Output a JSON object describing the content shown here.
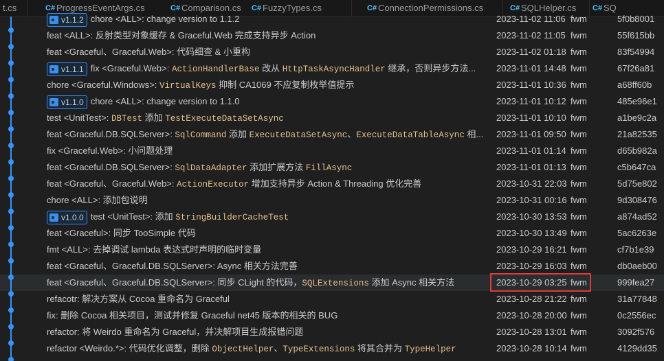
{
  "tabs": [
    {
      "label": "t.cs"
    },
    {
      "label": "ProgressEventArgs.cs"
    },
    {
      "label": "Comparison.cs"
    },
    {
      "label": "FuzzyTypes.cs"
    },
    {
      "label": "ConnectionPermissions.cs"
    },
    {
      "label": "SQLHelper.cs"
    },
    {
      "label": "SQ"
    }
  ],
  "commits": [
    {
      "tag": "v1.1.2",
      "parts": [
        {
          "t": "chore <ALL>: change version to 1.1.2"
        }
      ],
      "date": "2023-11-02 11:06",
      "author": "fwm",
      "hash": "5f0b8001"
    },
    {
      "tag": "",
      "parts": [
        {
          "t": "feat <ALL>: 反射类型对象缓存 & Graceful.Web 完成支持异步 Action"
        }
      ],
      "date": "2023-11-02 11:05",
      "author": "fwm",
      "hash": "55f615bb"
    },
    {
      "tag": "",
      "parts": [
        {
          "t": "feat <Graceful、Graceful.Web>: 代码细查 & 小重构"
        }
      ],
      "date": "2023-11-02 01:18",
      "author": "fwm",
      "hash": "83f54994"
    },
    {
      "tag": "v1.1.1",
      "parts": [
        {
          "t": "fix <Graceful.Web>: "
        },
        {
          "c": "ActionHandlerBase"
        },
        {
          "t": " 改从 "
        },
        {
          "c": "HttpTaskAsyncHandler"
        },
        {
          "t": " 继承，否则异步方法..."
        }
      ],
      "date": "2023-11-01 14:48",
      "author": "fwm",
      "hash": "67f26a81"
    },
    {
      "tag": "",
      "parts": [
        {
          "t": "chore <Graceful.Windows>: "
        },
        {
          "c": "VirtualKeys"
        },
        {
          "t": " 抑制 CA1069 不应复制枚举值提示"
        }
      ],
      "date": "2023-11-01 10:36",
      "author": "fwm",
      "hash": "a68ff60b"
    },
    {
      "tag": "v1.1.0",
      "parts": [
        {
          "t": "chore <ALL>: change version to 1.1.0"
        }
      ],
      "date": "2023-11-01 10:12",
      "author": "fwm",
      "hash": "485e96e1"
    },
    {
      "tag": "",
      "parts": [
        {
          "t": "test <UnitTest>: "
        },
        {
          "c": "DBTest"
        },
        {
          "t": " 添加 "
        },
        {
          "c": "TestExecuteDataSetAsync"
        }
      ],
      "date": "2023-11-01 10:10",
      "author": "fwm",
      "hash": "a1be9c2a"
    },
    {
      "tag": "",
      "parts": [
        {
          "t": "feat <Graceful.DB.SQLServer>: "
        },
        {
          "c": "SqlCommand"
        },
        {
          "t": " 添加 "
        },
        {
          "c": "ExecuteDataSetAsync"
        },
        {
          "t": "、"
        },
        {
          "c": "ExecuteDataTableAsync"
        },
        {
          "t": " 相..."
        }
      ],
      "date": "2023-11-01 09:50",
      "author": "fwm",
      "hash": "21a82535"
    },
    {
      "tag": "",
      "parts": [
        {
          "t": "fix <Graceful.Web>: 小问题处理"
        }
      ],
      "date": "2023-11-01 01:14",
      "author": "fwm",
      "hash": "d65b982a"
    },
    {
      "tag": "",
      "parts": [
        {
          "t": "feat <Graceful.DB.SQLServer>: "
        },
        {
          "c": "SqlDataAdapter"
        },
        {
          "t": " 添加扩展方法 "
        },
        {
          "c": "FillAsync"
        }
      ],
      "date": "2023-11-01 01:13",
      "author": "fwm",
      "hash": "c5b647ca"
    },
    {
      "tag": "",
      "parts": [
        {
          "t": "feat <Graceful、Graceful.Web>: "
        },
        {
          "c": "ActionExecutor"
        },
        {
          "t": " 增加支持异步 Action & Threading 优化完善"
        }
      ],
      "date": "2023-10-31 22:03",
      "author": "fwm",
      "hash": "5d75e802"
    },
    {
      "tag": "",
      "parts": [
        {
          "t": "chore <ALL>: 添加包说明"
        }
      ],
      "date": "2023-10-31 00:16",
      "author": "fwm",
      "hash": "9d308476"
    },
    {
      "tag": "v1.0.0",
      "parts": [
        {
          "t": "test <UnitTest>: 添加 "
        },
        {
          "c": "StringBuilderCacheTest"
        }
      ],
      "date": "2023-10-30 13:53",
      "author": "fwm",
      "hash": "a874ad52"
    },
    {
      "tag": "",
      "parts": [
        {
          "t": "feat <Graceful>: 同步 TooSimple 代码"
        }
      ],
      "date": "2023-10-30 13:49",
      "author": "fwm",
      "hash": "5ac6263e"
    },
    {
      "tag": "",
      "parts": [
        {
          "t": "fmt <ALL>: 去掉调试 lambda 表达式时声明的临时变量"
        }
      ],
      "date": "2023-10-29 16:21",
      "author": "fwm",
      "hash": "cf7b1e39"
    },
    {
      "tag": "",
      "parts": [
        {
          "t": "feat <Graceful、Graceful.DB.SQLServer>: Async 相关方法完善"
        }
      ],
      "date": "2023-10-29 16:03",
      "author": "fwm",
      "hash": "db0aeb00"
    },
    {
      "tag": "",
      "parts": [
        {
          "t": "feat <Graceful、Graceful.DB.SQLServer>: 同步 CLight 的代码，"
        },
        {
          "c": "SQLExtensions"
        },
        {
          "t": " 添加 Async 相关方法"
        }
      ],
      "date": "2023-10-29 03:25",
      "author": "fwm",
      "hash": "999fea27"
    },
    {
      "tag": "",
      "parts": [
        {
          "t": "refacotr: 解决方案从 Cocoa 重命名为 Graceful"
        }
      ],
      "date": "2023-10-28 21:22",
      "author": "fwm",
      "hash": "31a77848"
    },
    {
      "tag": "",
      "parts": [
        {
          "t": "fix: 删除 Cocoa 相关项目，测试并修复 Graceful net45 版本的相关的 BUG"
        }
      ],
      "date": "2023-10-28 20:00",
      "author": "fwm",
      "hash": "0c2556ec"
    },
    {
      "tag": "",
      "parts": [
        {
          "t": "refactor: 将 Weirdo 重命名为 Graceful，并决解项目生成报错问题"
        }
      ],
      "date": "2023-10-28 13:01",
      "author": "fwm",
      "hash": "3092f576"
    },
    {
      "tag": "",
      "parts": [
        {
          "t": "refactor <Weirdo.*>: 代码优化调整，删除 "
        },
        {
          "c": "ObjectHelper"
        },
        {
          "t": "、"
        },
        {
          "c": "TypeExtensions"
        },
        {
          "t": " 将其合并为 "
        },
        {
          "c": "TypeHelper"
        }
      ],
      "date": "2023-10-28 10:14",
      "author": "fwm",
      "hash": "4129dd35"
    }
  ],
  "selected_index": 16,
  "colors": {
    "background": "#1f1f1f",
    "graph_line": "#3794ff",
    "tag_border": "#3b8eea",
    "code_text": "#e2c08d",
    "highlight_box": "#e03a3a"
  }
}
